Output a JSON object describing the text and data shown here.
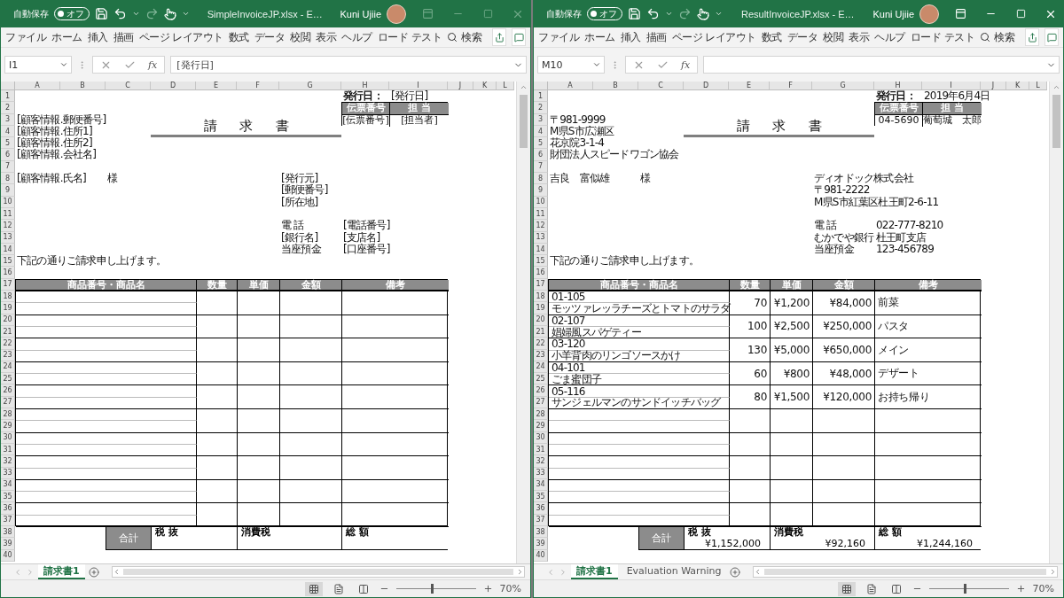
{
  "windows": [
    {
      "active": false,
      "autosave": {
        "label": "自動保存",
        "toggle": "オフ",
        "on": false
      },
      "file_title": "SimpleInvoiceJP.xlsx - E…",
      "user": "Kuni Ujiie",
      "menu": [
        "ファイル",
        "ホーム",
        "挿入",
        "描画",
        "ページ レイアウト",
        "数式",
        "データ",
        "校閲",
        "表示",
        "ヘルプ",
        "ロード テスト"
      ],
      "search": "検索",
      "name_box": "I1",
      "fx": "fx",
      "formula": "[発行日]",
      "columns": [
        "A",
        "B",
        "C",
        "D",
        "E",
        "F",
        "G",
        "H",
        "I",
        "J",
        "K",
        "L"
      ],
      "rows": [
        "1",
        "2",
        "3",
        "4",
        "5",
        "6",
        "7",
        "8",
        "9",
        "10",
        "11",
        "12",
        "13",
        "14",
        "15",
        "16",
        "17",
        "18",
        "19",
        "20",
        "21",
        "22",
        "23",
        "24",
        "25",
        "26",
        "27",
        "28",
        "29",
        "30",
        "31",
        "32",
        "33",
        "34",
        "35",
        "36",
        "37",
        "38",
        "39",
        "40"
      ],
      "sheet": {
        "issue_date_label": "発行日：",
        "issue_date": "[発行日]",
        "slip_headers": [
          "伝票番号",
          "担 当"
        ],
        "slip_values": [
          "[伝票番号]",
          "[担当者]"
        ],
        "customer_lines": [
          "[顧客情報.郵便番号]",
          "[顧客情報.住所1]",
          "[顧客情報.住所2]",
          "[顧客情報.会社名]"
        ],
        "title": "請求書",
        "customer_name": "[顧客情報.氏名]",
        "honorific": "様",
        "issuer_lines": [
          "[発行元]",
          "[郵便番号]",
          "[所在地]"
        ],
        "contact": [
          {
            "label": "電 話",
            "value": "[電話番号]"
          },
          {
            "label": "[銀行名]",
            "value": "[支店名]"
          },
          {
            "label": "当座預金",
            "value": "[口座番号]"
          }
        ],
        "message": "下記の通りご請求申し上げます。",
        "item_headers": [
          "商品番号・商品名",
          "数量",
          "単価",
          "金額",
          "備考"
        ],
        "totals": {
          "label": "合計",
          "cells": [
            {
              "label": "税 抜"
            },
            {
              "label": "消費税"
            },
            {
              "label": "総 額"
            }
          ]
        }
      },
      "sheet_tabs": [
        {
          "label": "請求書1",
          "selected": true
        }
      ],
      "zoom": {
        "level": 0.45,
        "label": "70%"
      }
    },
    {
      "active": true,
      "autosave": {
        "label": "自動保存",
        "toggle": "オフ",
        "on": false
      },
      "file_title": "ResultInvoiceJP.xlsx - E…",
      "user": "Kuni Ujiie",
      "menu": [
        "ファイル",
        "ホーム",
        "挿入",
        "描画",
        "ページ レイアウト",
        "数式",
        "データ",
        "校閲",
        "表示",
        "ヘルプ",
        "ロード テスト"
      ],
      "search": "検索",
      "name_box": "M10",
      "fx": "fx",
      "columns": [
        "A",
        "B",
        "C",
        "D",
        "E",
        "F",
        "G",
        "H",
        "I",
        "J",
        "K",
        "L"
      ],
      "rows": [
        "1",
        "2",
        "3",
        "4",
        "5",
        "6",
        "7",
        "8",
        "9",
        "10",
        "11",
        "12",
        "13",
        "14",
        "15",
        "16",
        "17",
        "18",
        "19",
        "20",
        "21",
        "22",
        "23",
        "24",
        "25",
        "26",
        "27",
        "28",
        "29",
        "30",
        "31",
        "32",
        "33",
        "34",
        "35",
        "36",
        "37",
        "38",
        "39",
        "40"
      ],
      "sheet": {
        "issue_date_label": "発行日：",
        "issue_date": "2019年6月4日",
        "slip_headers": [
          "伝票番号",
          "担 当"
        ],
        "slip_values": [
          "04-5690",
          "葡萄城　太郎"
        ],
        "customer_lines": [
          "〒981-9999",
          "M県S市広瀬区",
          "花京院3-1-4",
          "財団法人スピードワゴン協会"
        ],
        "title": "請求書",
        "customer_name": "吉良　富似雄",
        "honorific": "様",
        "issuer_lines": [
          "ディオドック株式会社",
          "〒981-2222",
          "M県S市紅葉区杜王町2-6-11"
        ],
        "contact": [
          {
            "label": "電 話",
            "value": "022-777-8210"
          },
          {
            "label": "むかでや銀行",
            "value": "杜王町支店"
          },
          {
            "label": "当座預金",
            "value": "123-456789"
          }
        ],
        "message": "下記の通りご請求申し上げます。",
        "item_headers": [
          "商品番号・商品名",
          "数量",
          "単価",
          "金額",
          "備考"
        ],
        "items": [
          {
            "code": "01-105",
            "name": "モッツァレッラチーズとトマトのサラダ",
            "qty": "70",
            "price": "¥1,200",
            "amount": "¥84,000",
            "note": "前菜"
          },
          {
            "code": "02-107",
            "name": "娼婦風スパゲティー",
            "qty": "100",
            "price": "¥2,500",
            "amount": "¥250,000",
            "note": "パスタ"
          },
          {
            "code": "03-120",
            "name": "小羊背肉のリンゴソースかけ",
            "qty": "130",
            "price": "¥5,000",
            "amount": "¥650,000",
            "note": "メイン"
          },
          {
            "code": "04-101",
            "name": "ごま蜜団子",
            "qty": "60",
            "price": "¥800",
            "amount": "¥48,000",
            "note": "デザート"
          },
          {
            "code": "05-116",
            "name": "サンジェルマンのサンドイッチバッグ",
            "qty": "80",
            "price": "¥1,500",
            "amount": "¥120,000",
            "note": "お持ち帰り"
          }
        ],
        "totals": {
          "label": "合計",
          "cells": [
            {
              "label": "税 抜",
              "value": "¥1,152,000"
            },
            {
              "label": "消費税",
              "value": "¥92,160"
            },
            {
              "label": "総 額",
              "value": "¥1,244,160"
            }
          ]
        }
      },
      "sheet_tabs": [
        {
          "label": "請求書1",
          "selected": true
        },
        {
          "label": "Evaluation Warning",
          "selected": false
        }
      ],
      "zoom": {
        "level": 0.45,
        "label": "70%"
      }
    }
  ]
}
